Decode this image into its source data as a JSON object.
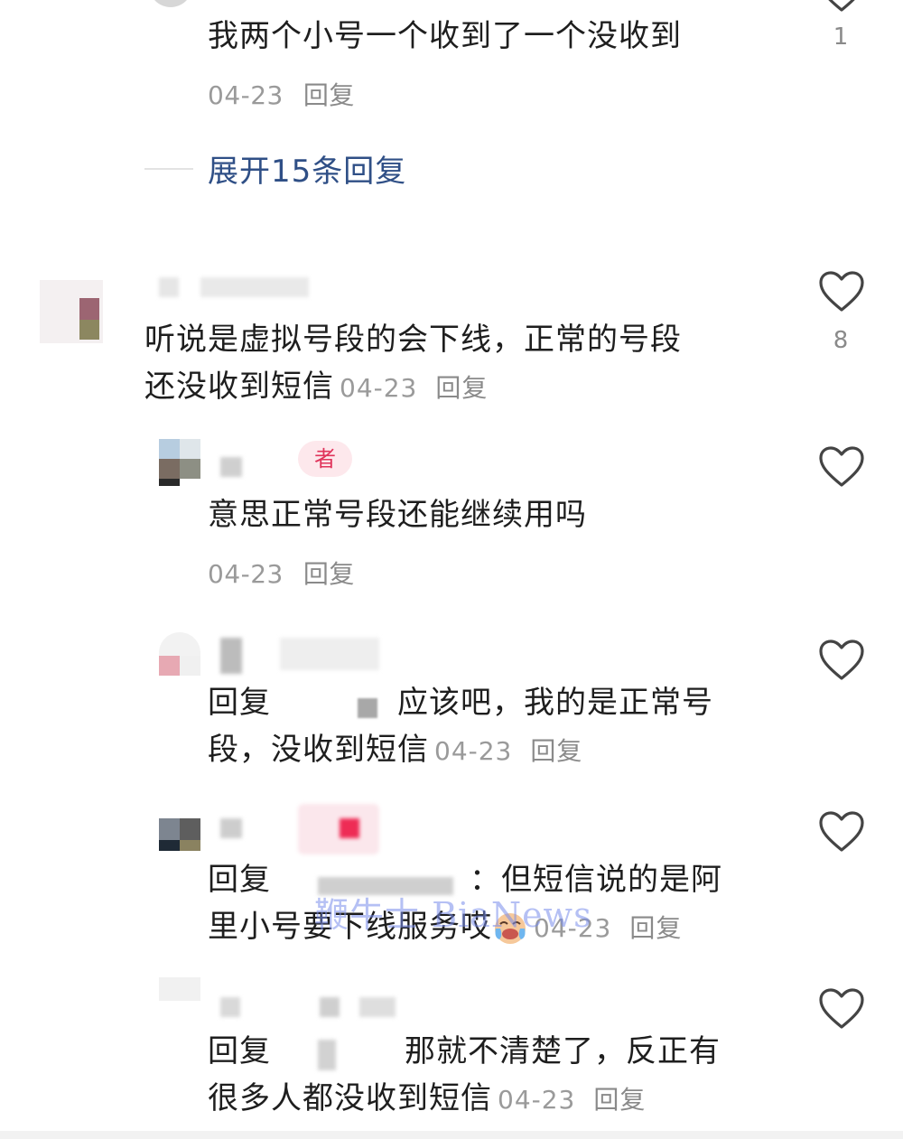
{
  "comments": [
    {
      "text": "我两个小号一个收到了一个没收到",
      "date": "04-23",
      "reply_label": "回复",
      "likes": "1"
    },
    {
      "expand_label": "展开15条回复"
    },
    {
      "text": "听说是虚拟号段的会下线，正常的号段还没收到短信",
      "text_line1": "听说是虚拟号段的会下线，正常的号段",
      "text_line2": "还没收到短信",
      "date": "04-23",
      "reply_label": "回复",
      "likes": "8"
    },
    {
      "badge": "者",
      "text": "意思正常号段还能继续用吗",
      "date": "04-23",
      "reply_label": "回复"
    },
    {
      "prefix": "回复",
      "text_line1": "应该吧，我的是正常号",
      "text_line2": "段，没收到短信",
      "date": "04-23",
      "reply_label": "回复"
    },
    {
      "prefix": "回复",
      "text_line1": "：但短信说的是阿",
      "text_line2": "里小号要下线服务哎",
      "date": "04-23",
      "reply_label": "回复"
    },
    {
      "prefix": "回复",
      "text_line1": "那就不清楚了，反正有",
      "text_line2": "很多人都没收到短信",
      "date": "04-23",
      "reply_label": "回复"
    }
  ],
  "watermark": "鞭牛士 BiaNews",
  "icons": {
    "like": "heart-outline-icon",
    "emoji": "crying-laughing-emoji-icon"
  },
  "colors": {
    "expand_link": "#2f4f86",
    "meta": "#9a9a9a",
    "badge_bg": "#fde8ec",
    "badge_text": "#e0335a",
    "heart": "#444444"
  }
}
